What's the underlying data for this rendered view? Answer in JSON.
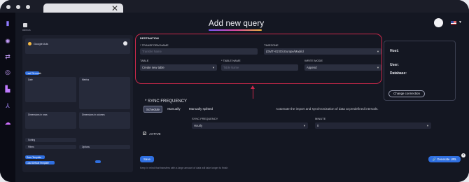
{
  "page": {
    "title": "Add new query",
    "brand_label": "DRINGS"
  },
  "left_preview": {
    "source_title": "Google Ads",
    "labels": [
      "Date",
      "Metrics",
      "Dimensions in rows",
      "Dimensions in columns",
      "Sorting",
      "Filters",
      "Options"
    ],
    "buttons": [
      "Last 7th month",
      "Save Template",
      "Load Default Template"
    ]
  },
  "destination": {
    "section_label": "DESTINATION",
    "transform_name_label": "TRANSFORM NAME",
    "transform_name_placeholder": "Transfer Name",
    "timezone_label": "TIMEZONE",
    "timezone_value": "(GMT+02:00) Europe/Madrid",
    "table_label": "TABLE",
    "table_value": "Create new table",
    "table_name_label": "TABLE NAME",
    "table_name_placeholder": "Table Name",
    "write_mode_label": "WRITE MODE",
    "write_mode_value": "Append"
  },
  "connection": {
    "host_label": "Host:",
    "user_label": "User:",
    "database_label": "Database:",
    "change_button": "Change connection"
  },
  "sync": {
    "title": "SYNC FREQUENCY",
    "tabs": [
      "Schedule",
      "Manually",
      "Manually splitted"
    ],
    "description": "Automate the import and synchronization of data at predefined intervals.",
    "frequency_label": "SYNC FREQUENCY",
    "frequency_value": "Hourly",
    "minute_label": "MINUTE",
    "minute_value": "0",
    "active_label": "ACTIVE"
  },
  "footer": {
    "save_label": "Save",
    "note": "Keep in mind that transfers with a large amount of data will take longer to finish",
    "generate_label": "Generate URL",
    "help_label": "?"
  },
  "colors": {
    "accent": "#2f6fe0",
    "highlight": "#c9284a",
    "background": "#141722"
  },
  "icons": [
    "close-icon",
    "user-avatar-icon",
    "flag-icon",
    "chevron-down-icon",
    "link-icon",
    "help-icon"
  ]
}
